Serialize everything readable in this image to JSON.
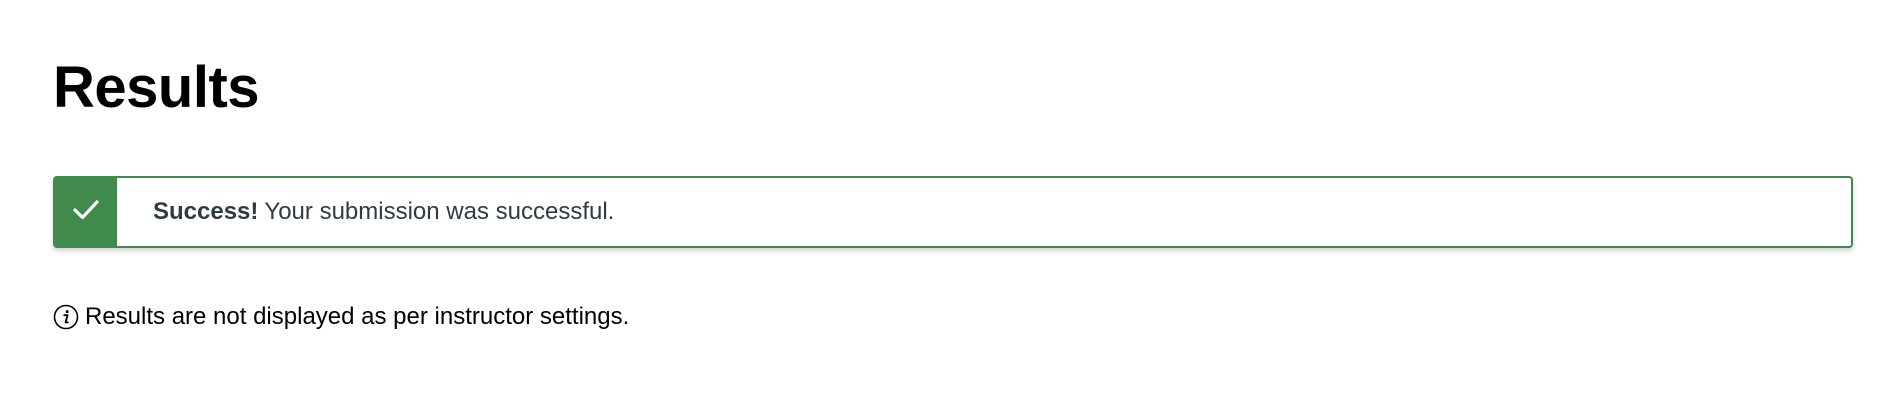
{
  "page": {
    "title": "Results"
  },
  "alert": {
    "type": "success",
    "icon": "checkmark-icon",
    "strong_text": "Success!",
    "message": "Your submission was successful.",
    "accent_color": "#3f8a4c"
  },
  "info": {
    "icon": "info-icon",
    "text": "Results are not displayed as per instructor settings."
  }
}
